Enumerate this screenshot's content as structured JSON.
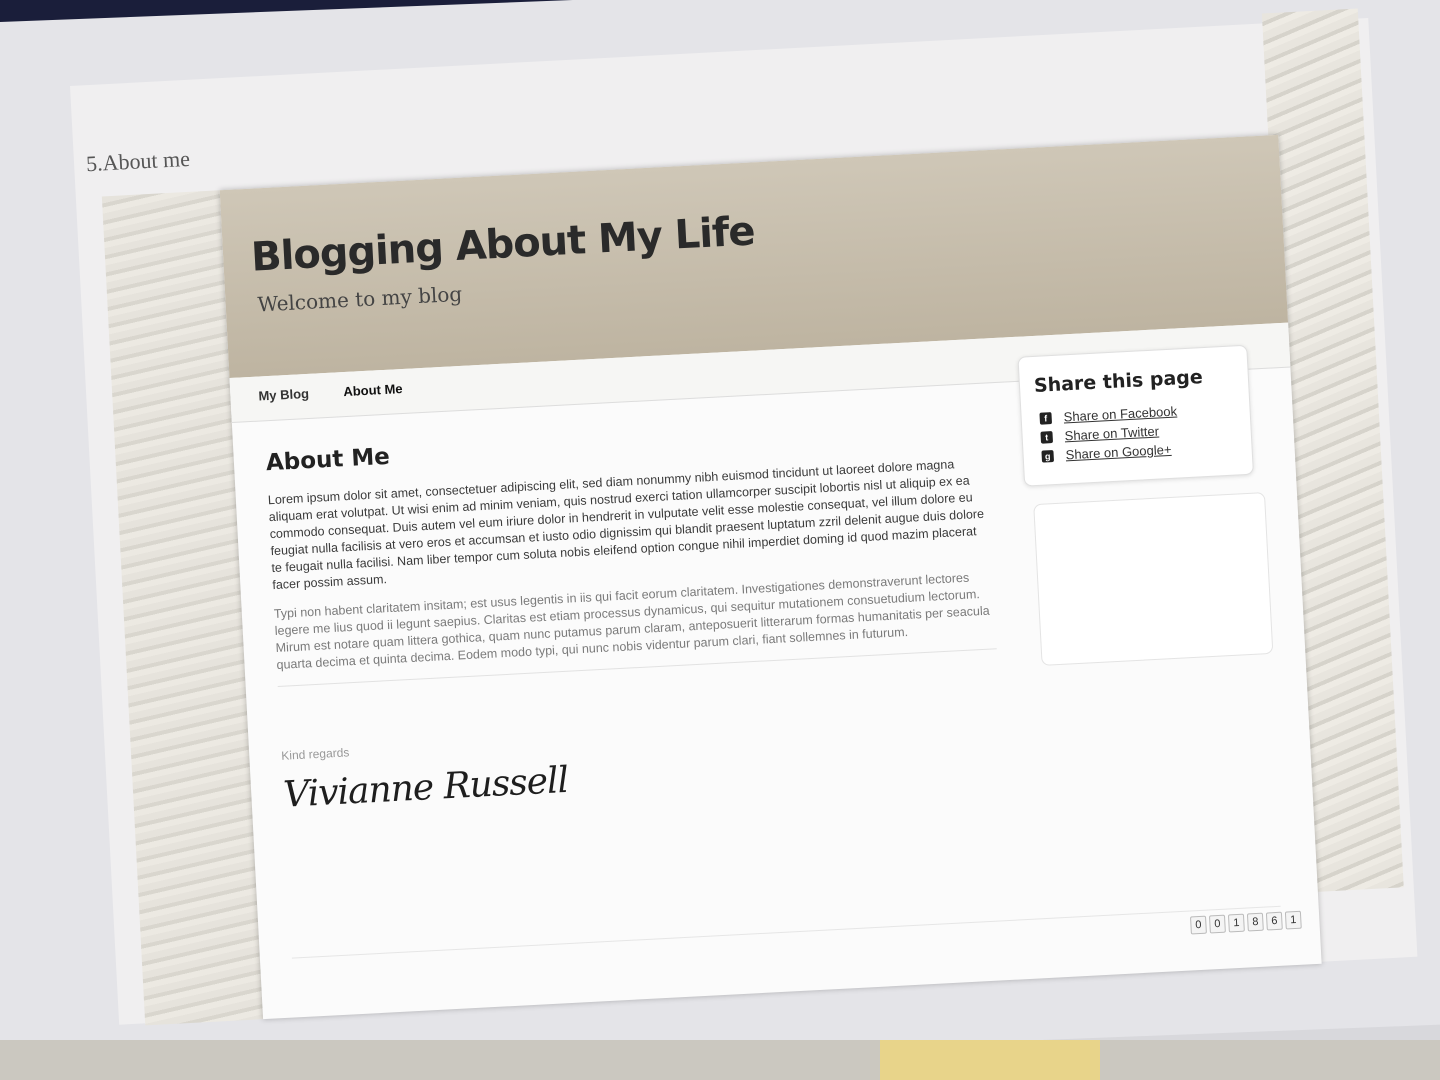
{
  "section_label": "5.About me",
  "site": {
    "title": "Blogging About My Life",
    "tagline": "Welcome to my blog"
  },
  "nav": {
    "items": [
      {
        "label": "My Blog"
      },
      {
        "label": "About Me"
      }
    ]
  },
  "main": {
    "heading": "About Me",
    "paragraphs": [
      "Lorem ipsum dolor sit amet, consectetuer adipiscing elit, sed diam nonummy nibh euismod tincidunt ut laoreet dolore magna aliquam erat volutpat. Ut wisi enim ad minim veniam, quis nostrud exerci tation ullamcorper suscipit lobortis nisl ut aliquip ex ea commodo consequat. Duis autem vel eum iriure dolor in hendrerit in vulputate velit esse molestie consequat, vel illum dolore eu feugiat nulla facilisis at vero eros et accumsan et iusto odio dignissim qui blandit praesent luptatum zzril delenit augue duis dolore te feugait nulla facilisi. Nam liber tempor cum soluta nobis eleifend option congue nihil imperdiet doming id quod mazim placerat facer possim assum.",
      "Typi non habent claritatem insitam; est usus legentis in iis qui facit eorum claritatem. Investigationes demonstraverunt lectores legere me lius quod ii legunt saepius. Claritas est etiam processus dynamicus, qui sequitur mutationem consuetudium lectorum. Mirum est notare quam littera gothica, quam nunc putamus parum claram, anteposuerit litterarum formas humanitatis per seacula quarta decima et quinta decima. Eodem modo typi, qui nunc nobis videntur parum clari, fiant sollemnes in futurum."
    ],
    "closing": "Kind regards",
    "signature": "Vivianne Russell"
  },
  "sidebar": {
    "title": "Share this page",
    "links": [
      {
        "label": "Share on Facebook",
        "icon": "facebook-icon",
        "glyph": "f"
      },
      {
        "label": "Share on Twitter",
        "icon": "twitter-icon",
        "glyph": "t"
      },
      {
        "label": "Share on Google+",
        "icon": "googleplus-icon",
        "glyph": "g"
      }
    ]
  },
  "footer": {
    "counter_digits": [
      "0",
      "0",
      "1",
      "8",
      "6",
      "1"
    ]
  },
  "colors": {
    "header_bg": "#c6bdac",
    "page_bg": "#fbfbfb",
    "text": "#3a3a3a"
  }
}
